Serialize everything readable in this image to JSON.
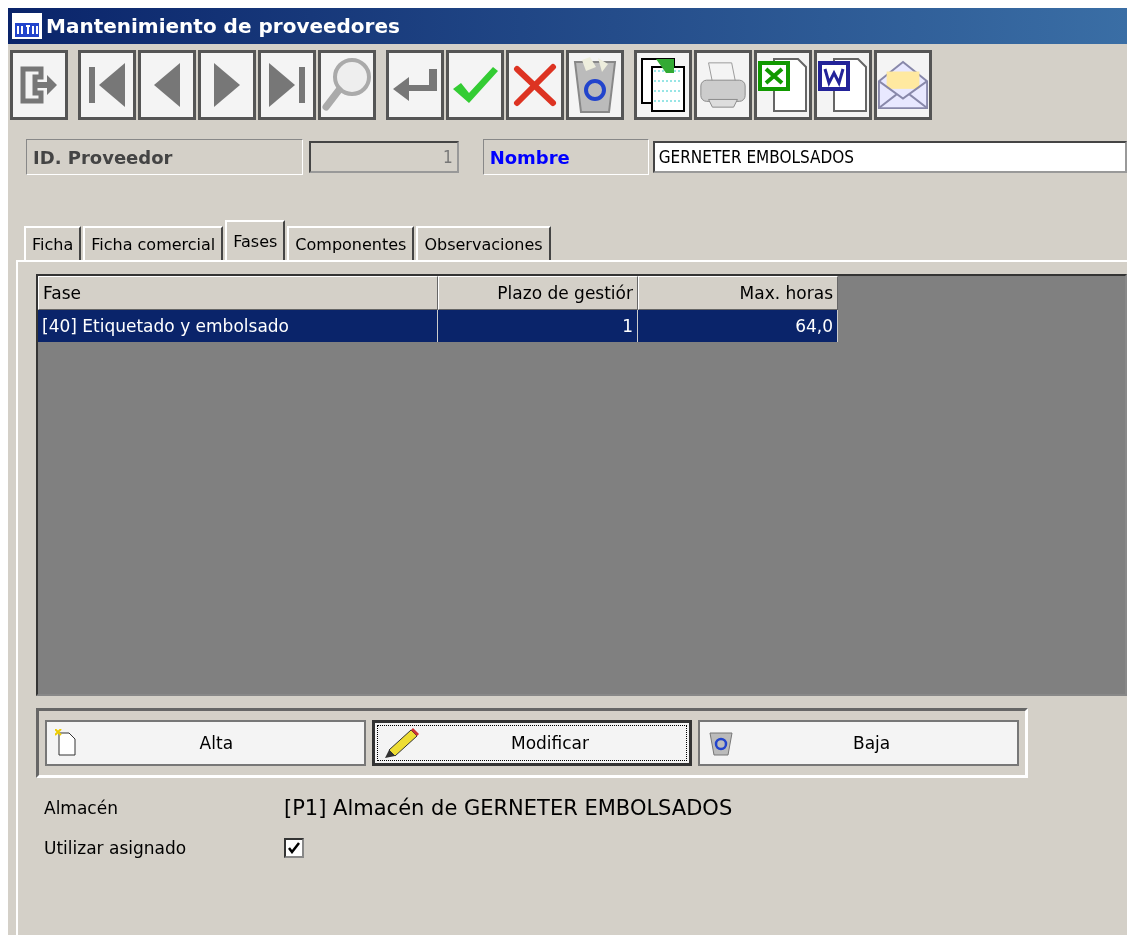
{
  "window": {
    "title": "Mantenimiento de proveedores"
  },
  "toolbar": [
    {
      "kind": "exit"
    },
    {
      "kind": "first"
    },
    {
      "kind": "prev"
    },
    {
      "kind": "next"
    },
    {
      "kind": "last"
    },
    {
      "kind": "search"
    },
    {
      "kind": "return"
    },
    {
      "kind": "accept"
    },
    {
      "kind": "cancel"
    },
    {
      "kind": "trash"
    },
    {
      "kind": "copy"
    },
    {
      "kind": "print"
    },
    {
      "kind": "excel"
    },
    {
      "kind": "word"
    },
    {
      "kind": "mail"
    }
  ],
  "id_field": {
    "label": "ID. Proveedor",
    "value": "1"
  },
  "name_field": {
    "label": "Nombre",
    "value": "GERNETER EMBOLSADOS"
  },
  "tabs": [
    {
      "label": "Ficha",
      "selected": false
    },
    {
      "label": "Ficha comercial",
      "selected": false
    },
    {
      "label": "Fases",
      "selected": true
    },
    {
      "label": "Componentes",
      "selected": false
    },
    {
      "label": "Observaciones",
      "selected": false
    }
  ],
  "table": {
    "columns": [
      "Fase",
      "Plazo de gestiór",
      "Max. horas"
    ],
    "rows": [
      {
        "cells": [
          "[40] Etiquetado y embolsado",
          "1",
          "64,0"
        ],
        "selected": true
      }
    ]
  },
  "buttons": [
    {
      "kind": "new",
      "label": "Alta",
      "focused": false
    },
    {
      "kind": "edit",
      "label": "Modificar",
      "focused": true
    },
    {
      "kind": "delete",
      "label": "Baja",
      "focused": false
    }
  ],
  "almacen": {
    "label": "Almacén",
    "value": "[P1] Almacén de GERNETER EMBOLSADOS"
  },
  "utilizar": {
    "label": "Utilizar asignado",
    "checked": true
  }
}
